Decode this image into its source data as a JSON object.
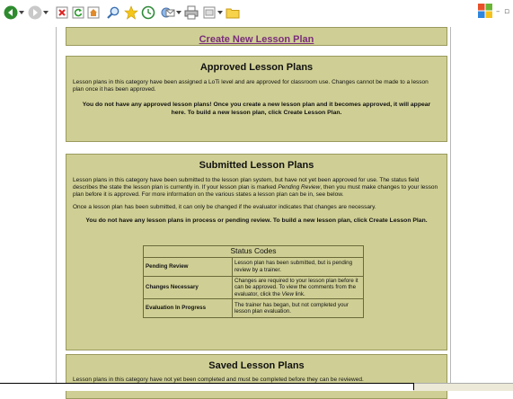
{
  "toolbar": {
    "icons": [
      "back-icon",
      "dropdown-arrow-icon",
      "forward-icon",
      "dropdown-arrow-icon",
      "stop-icon",
      "refresh-icon",
      "home-icon",
      "search-icon",
      "favorites-icon",
      "history-icon",
      "mail-icon",
      "print-icon",
      "edit-icon",
      "folder-icon"
    ]
  },
  "create": {
    "label": "Create New Lesson Plan"
  },
  "approved": {
    "title": "Approved Lesson Plans",
    "desc": "Lesson plans in this category have been assigned a LoTi level and are approved for classroom use. Changes cannot be made to a lesson plan once it has been approved.",
    "empty": "You do not have any approved lesson plans! Once you create a new lesson plan and it becomes approved, it will appear here. To build a new lesson plan, click Create Lesson Plan."
  },
  "submitted": {
    "title": "Submitted Lesson Plans",
    "desc_a": "Lesson plans in this category have been submitted to the lesson plan system, but have not yet been approved for use. The status field describes the state the lesson plan is currently in. If your lesson plan is marked ",
    "desc_em": "Pending Review",
    "desc_b": ", then you must make changes to your lesson plan before it is approved. For more information on the various states a lesson plan can be in, see below.",
    "note": "Once a lesson plan has been submitted, it can only be changed if the evaluator indicates that changes are necessary.",
    "empty": "You do not have any lesson plans in process or pending review. To build a new lesson plan, click Create Lesson Plan.",
    "codes_header": "Status Codes",
    "codes": [
      {
        "status": "Pending Review",
        "desc": "Lesson plan has been submitted, but is pending review by a trainer."
      },
      {
        "status": "Changes Necessary",
        "desc_a": "Changes are required to your lesson plan before it can be approved. To view the comments from the evaluator, click the ",
        "desc_em": "View",
        "desc_b": " link."
      },
      {
        "status": "Evaluation In Progress",
        "desc": "The trainer has began, but not completed your lesson plan evaluation."
      }
    ]
  },
  "saved": {
    "title": "Saved Lesson Plans",
    "desc": "Lesson plans in this category have not yet been completed and must be completed before they can be reviewed."
  },
  "colors": {
    "panel": "#cfcf95",
    "border": "#9a9a5e",
    "link": "#7a2d7a"
  }
}
